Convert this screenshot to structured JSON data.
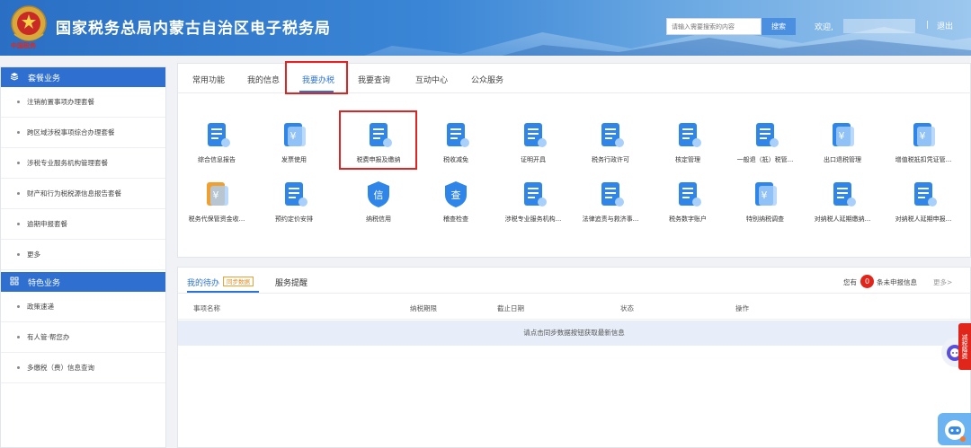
{
  "header": {
    "title": "国家税务总局内蒙古自治区电子税务局",
    "emblem_text": "中国税务",
    "search_placeholder": "请输入需要搜索的内容",
    "search_button": "搜索",
    "welcome": "欢迎,",
    "separator": "|",
    "logout": "退出"
  },
  "sidebar": {
    "package_title": "套餐业务",
    "package_items": [
      "注销前置事项办理套餐",
      "跨区域涉税事项综合办理套餐",
      "涉税专业服务机构管理套餐",
      "财产和行为税税源信息报告套餐",
      "逾期申报套餐",
      "更多"
    ],
    "feature_title": "特色业务",
    "feature_items": [
      "政策速递",
      "有人管·帮您办",
      "多缴税（费）信息查询"
    ]
  },
  "tabs": [
    "常用功能",
    "我的信息",
    "我要办税",
    "我要查询",
    "互动中心",
    "公众服务"
  ],
  "active_tab": 2,
  "apps": [
    {
      "label": "综合信息报告",
      "icon": "report-icon",
      "color": "#2f86e8"
    },
    {
      "label": "发票使用",
      "icon": "invoice-icon",
      "color": "#2f86e8"
    },
    {
      "label": "税费申报及缴纳",
      "icon": "tax-declare-icon",
      "color": "#2f86e8"
    },
    {
      "label": "税收减免",
      "icon": "tax-relief-icon",
      "color": "#2f86e8"
    },
    {
      "label": "证明开具",
      "icon": "certificate-icon",
      "color": "#2f86e8"
    },
    {
      "label": "税务行政许可",
      "icon": "license-icon",
      "color": "#2f86e8"
    },
    {
      "label": "核定管理",
      "icon": "approval-icon",
      "color": "#2f86e8"
    },
    {
      "label": "一般退（抵）税管...",
      "icon": "refund-icon",
      "color": "#2f86e8"
    },
    {
      "label": "出口退税管理",
      "icon": "export-refund-icon",
      "color": "#2f86e8"
    },
    {
      "label": "增值税抵扣凭证管...",
      "icon": "vat-icon",
      "color": "#2f86e8"
    },
    {
      "label": "税务代保管资金收...",
      "icon": "fund-icon",
      "color": "#f0a030"
    },
    {
      "label": "预约定价安排",
      "icon": "schedule-icon",
      "color": "#2f86e8"
    },
    {
      "label": "纳税信用",
      "icon": "credit-icon",
      "color": "#2f86e8"
    },
    {
      "label": "稽查检查",
      "icon": "inspection-icon",
      "color": "#2f86e8"
    },
    {
      "label": "涉税专业服务机构...",
      "icon": "agency-icon",
      "color": "#2f86e8"
    },
    {
      "label": "法律追责与救济事...",
      "icon": "law-icon",
      "color": "#2f86e8"
    },
    {
      "label": "税务数字账户",
      "icon": "account-icon",
      "color": "#2f86e8"
    },
    {
      "label": "特别纳税调查",
      "icon": "investigation-icon",
      "color": "#2f86e8"
    },
    {
      "label": "对纳税人延期缴纳...",
      "icon": "deferred-pay-icon",
      "color": "#2f86e8"
    },
    {
      "label": "对纳税人延期申报...",
      "icon": "deferred-declare-icon",
      "color": "#2f86e8"
    }
  ],
  "app_glyphs": {
    "fund-icon": "¥",
    "credit-icon": "信",
    "inspection-icon": "查",
    "invoice-icon": "¥",
    "vat-icon": "¥",
    "export-refund-icon": "¥",
    "investigation-icon": "¥"
  },
  "todo": {
    "tab_active": "我的待办",
    "sync_badge": "同步数据",
    "tab_other": "服务提醒",
    "notice_pre": "您有",
    "notice_count": "0",
    "notice_post": "条未申报信息",
    "more": "更多>",
    "columns": [
      "事项名称",
      "纳税期限",
      "截止日期",
      "状态",
      "操作"
    ],
    "empty_text": "请点击同步数据按钮获取最新信息"
  },
  "float": {
    "side_tab": "减税降费"
  }
}
